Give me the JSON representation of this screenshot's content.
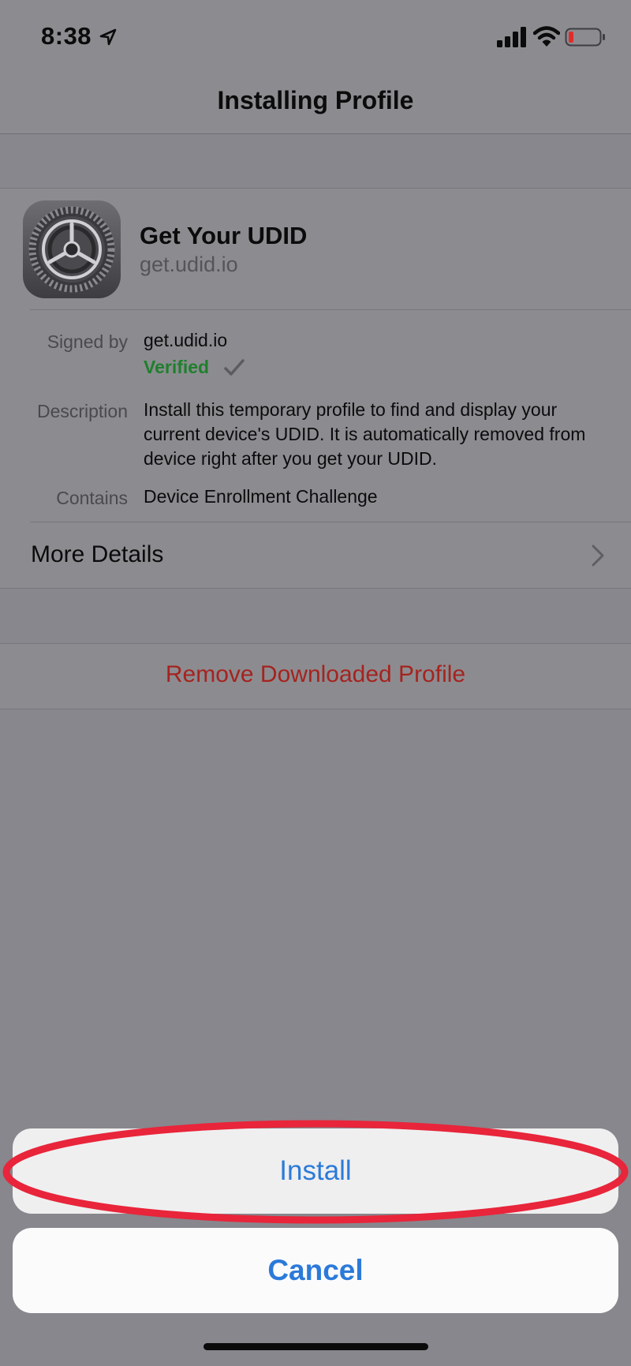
{
  "status_bar": {
    "time": "8:38",
    "icons": [
      "location-arrow-icon",
      "cellular-signal-icon",
      "wifi-icon",
      "battery-low-icon"
    ]
  },
  "nav": {
    "title": "Installing Profile"
  },
  "profile": {
    "icon": "settings-gear-icon",
    "name": "Get Your UDID",
    "domain": "get.udid.io",
    "signed_by_label": "Signed by",
    "signed_by_value": "get.udid.io",
    "verified_label": "Verified",
    "description_label": "Description",
    "description_value": "Install this temporary profile to find and display your current device's UDID. It is automatically removed from device right after you get your UDID.",
    "contains_label": "Contains",
    "contains_value": "Device Enrollment Challenge",
    "more_details_label": "More Details"
  },
  "remove": {
    "label": "Remove Downloaded Profile"
  },
  "action_sheet": {
    "install_label": "Install",
    "cancel_label": "Cancel"
  },
  "colors": {
    "dimmed_background": "#88878d",
    "accent_blue": "#2b7ad9",
    "destructive_red": "#a5231f",
    "verified_green": "#1f7f2d",
    "highlight_ring": "#e8253a"
  }
}
